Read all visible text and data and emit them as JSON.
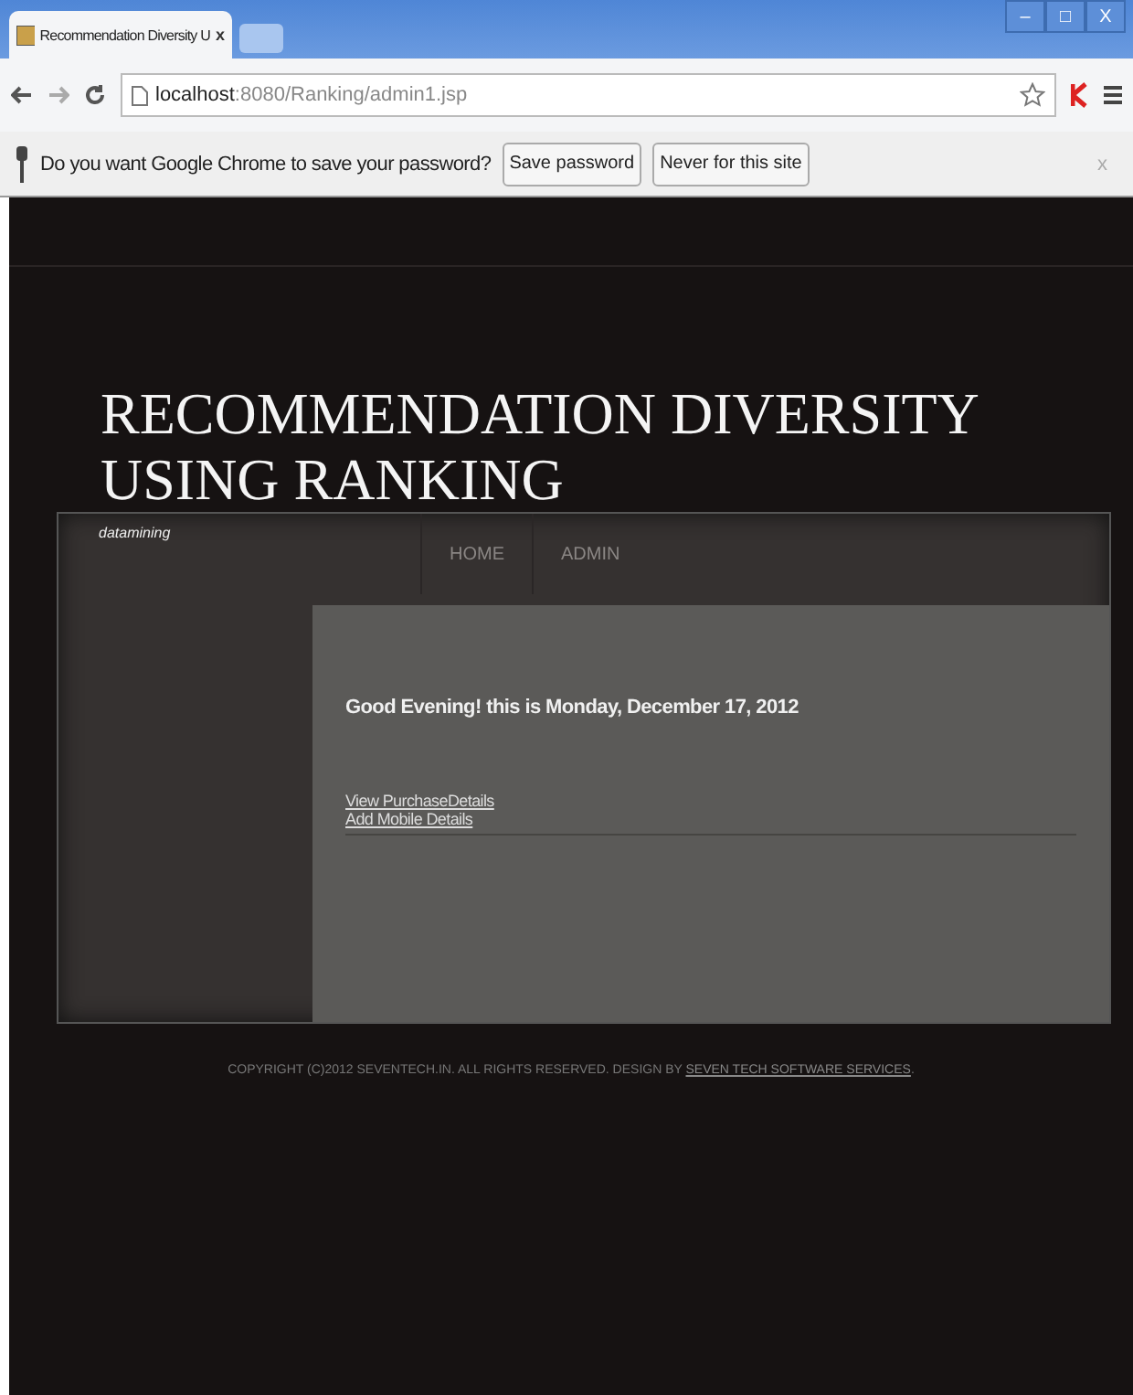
{
  "browser": {
    "tab_title": "Recommendation Diversity U",
    "tab_close": "x",
    "window_buttons": [
      "–",
      "□",
      "X"
    ],
    "url_host": "localhost",
    "url_path": ":8080/Ranking/admin1.jsp"
  },
  "password_bar": {
    "question": "Do you want Google Chrome to save your password?",
    "buttons": [
      "Save password",
      "Never for this site"
    ],
    "close": "x"
  },
  "site": {
    "title": "RECOMMENDATION DIVERSITY USING RANKING",
    "tagline": "datamining",
    "nav": [
      {
        "label": "HOME"
      },
      {
        "label": "ADMIN"
      }
    ],
    "greeting": "Good Evening! this is Monday, December 17, 2012",
    "links": [
      "View PurchaseDetails",
      "Add Mobile Details"
    ],
    "footer": "COPYRIGHT (C)2012 SEVENTECH.IN. ALL RIGHTS RESERVED. DESIGN BY",
    "footer_link": "SEVEN TECH SOFTWARE SERVICES",
    "footer_end": "."
  }
}
